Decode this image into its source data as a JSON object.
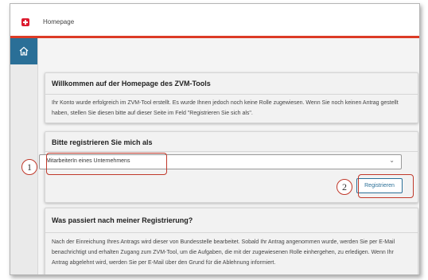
{
  "header": {
    "title": "Homepage"
  },
  "sidebar": {
    "home_icon": "home-icon"
  },
  "welcome": {
    "heading": "Willkommen auf der Homepage des ZVM-Tools",
    "text": "Ihr Konto wurde erfolgreich im ZVM-Tool erstellt. Es wurde Ihnen jedoch noch keine Rolle zugewiesen. Wenn Sie noch keinen Antrag gestellt haben, stellen Sie diesen bitte auf dieser Seite im Feld \"Registrieren Sie sich als\"."
  },
  "register": {
    "heading": "Bitte registrieren Sie mich als",
    "select_value": "MitarbeiterIn eines Unternehmens",
    "button_label": "Registrieren"
  },
  "after": {
    "heading": "Was passiert nach meiner Registrierung?",
    "text": "Nach der Einreichung Ihres Antrags wird dieser von Bundesstelle bearbeitet. Sobald Ihr Antrag angenommen wurde, werden Sie per E-Mail benachrichtigt und erhalten Zugang zum ZVM-Tool, um die Aufgaben, die mit der zugewiesenen Rolle einhergehen, zu erledigen. Wenn Ihr Antrag abgelehnt wird, werden Sie per E-Mail über den Grund für die Ablehnung informiert."
  },
  "callouts": {
    "one": "1",
    "two": "2"
  },
  "colors": {
    "accent": "#dc3b26",
    "primary": "#2a6f97",
    "highlight": "#c0392b"
  }
}
